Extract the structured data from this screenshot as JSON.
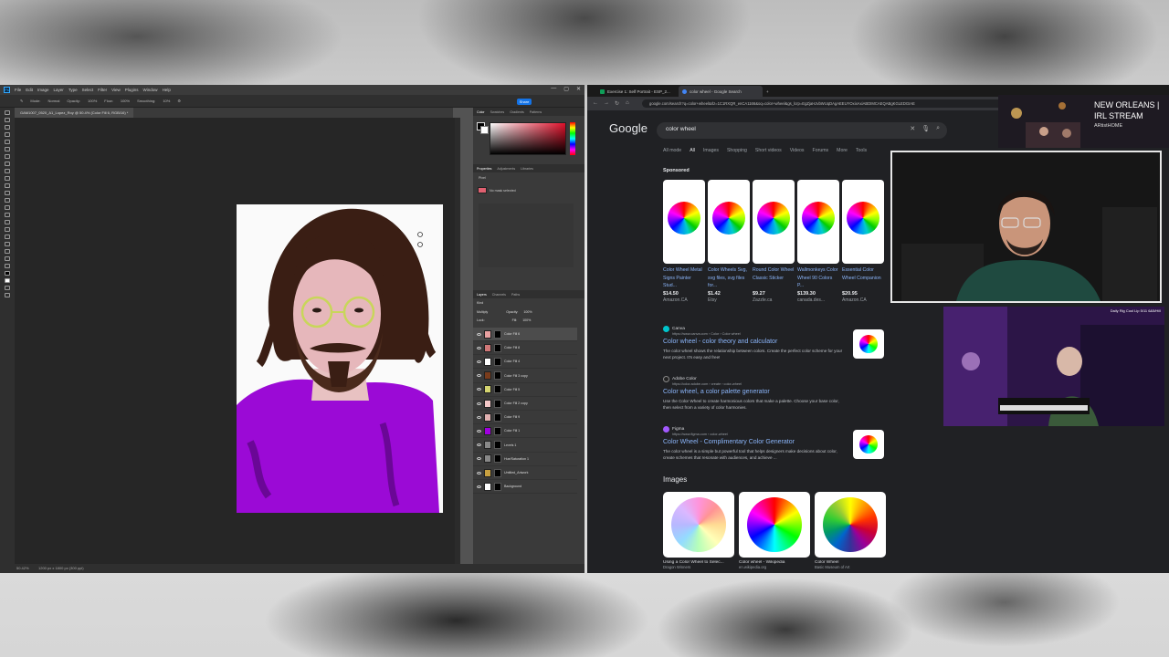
{
  "photoshop": {
    "menu": [
      "File",
      "Edit",
      "Image",
      "Layer",
      "Type",
      "Select",
      "Filter",
      "View",
      "Plugins",
      "Window",
      "Help"
    ],
    "window_controls": [
      "—",
      "▢",
      "✕"
    ],
    "options_bar": [
      "Mode:",
      "Normal",
      "Opacity:",
      "100%",
      "Flow:",
      "100%",
      "Smoothing:",
      "10%"
    ],
    "share_label": "Share",
    "document_tab": "GAM1007_0520_A1_Lopez_Roy @ 50.4% (Color Fill 6, RGB/16) *",
    "status_zoom": "50.42%",
    "status_size": "1200 px x 1800 px (300 ppi)",
    "color_panel_tabs": [
      "Color",
      "Swatches",
      "Gradients",
      "Patterns"
    ],
    "properties_tabs": [
      "Properties",
      "Adjustments",
      "Libraries"
    ],
    "properties_type": "Pixel",
    "properties_msg": "No mask selected",
    "layers_tabs": [
      "Layers",
      "Channels",
      "Paths"
    ],
    "layer_kind": "Kind",
    "blend_mode": "Multiply",
    "opacity_label": "Opacity:",
    "opacity_value": "100%",
    "lock_label": "Lock:",
    "fill_label": "Fill:",
    "fill_value": "100%",
    "layers": [
      {
        "name": "Color Fill 6",
        "color": "#e8a0a0",
        "selected": true
      },
      {
        "name": "Color Fill 8",
        "color": "#d07878"
      },
      {
        "name": "Color Fill 4",
        "color": "#ffffff"
      },
      {
        "name": "Color Fill 3 copy",
        "color": "#7a3c1c"
      },
      {
        "name": "Color Fill 5",
        "color": "#d4d470"
      },
      {
        "name": "Color Fill 2 copy",
        "color": "#f4c8c8"
      },
      {
        "name": "Color Fill 9",
        "color": "#e0b0b0"
      },
      {
        "name": "Color Fill 1",
        "color": "#a000e0"
      },
      {
        "name": "Levels 1",
        "color": "#888888"
      },
      {
        "name": "Hue/Saturation 1",
        "color": "#888888"
      },
      {
        "name": "Untitled_Artwork",
        "color": "#c8a040"
      },
      {
        "name": "Background",
        "color": "#ffffff"
      }
    ]
  },
  "browser": {
    "tabs": [
      {
        "label": "Exercise 1: Self Portrait - ESP_2...",
        "favicon": "#0f9d58"
      },
      {
        "label": "color wheel - Google Search",
        "favicon": "#4285f4"
      }
    ],
    "new_tab": "+",
    "url": "google.com/search?q=color+wheel&rlz=1C1RXQR_enCA1166&oq=color+wheel&gs_lcrp=EgZjaHJvbWUqDAgAEEUYOxixAxiABDIMCAEQABgKGLEDGIAE",
    "nav": [
      "←",
      "→",
      "↻",
      "⌂"
    ]
  },
  "google": {
    "logo": "Google",
    "query": "color wheel",
    "search_icons": [
      "✕",
      "🎙",
      "⌕"
    ],
    "filters": [
      "All mode",
      "All",
      "Images",
      "Shopping",
      "Short videos",
      "Videos",
      "Forums",
      "More",
      "Tools"
    ],
    "sponsored": "Sponsored",
    "products": [
      {
        "title": "Color Wheel Metal Signs Painter Stud...",
        "price": "$14.50",
        "store": "Amazon.CA"
      },
      {
        "title": "Color Wheels Svg, svg files, svg files for...",
        "price": "$1.42",
        "store": "Etsy"
      },
      {
        "title": "Round Color Wheel Classic Sticker",
        "price": "$9.27",
        "store": "Zazzle.ca"
      },
      {
        "title": "Wallmonkeys Color Wheel 90 Colors P...",
        "price": "$139.30",
        "store": "canada.des..."
      },
      {
        "title": "Essential Color Wheel Companion",
        "price": "$20.95",
        "store": "Amazon.CA"
      }
    ],
    "results": [
      {
        "site": "Canva",
        "url": "https://www.canva.com › Color › Color wheel",
        "title": "Color wheel - color theory and calculator",
        "desc": "The color wheel shows the relationship between colors. Create the perfect color scheme for your next project. It's easy and free!",
        "icon": "#00c4cc"
      },
      {
        "site": "Adobe Color",
        "url": "https://color.adobe.com › create › color-wheel",
        "title": "Color wheel, a color palette generator",
        "desc": "Use the Color Wheel to create harmonious colors that make a palette. Choose your base color, then select from a variety of color harmonies.",
        "icon": "#222222"
      },
      {
        "site": "Figma",
        "url": "https://www.figma.com › color-wheel",
        "title": "Color Wheel - Complimentary Color Generator",
        "desc": "The color wheel is a simple but powerful tool that helps designers make decisions about color, create schemes that resonate with audiences, and achieve ...",
        "icon": "#a259ff"
      }
    ],
    "images_heading": "Images",
    "images": [
      {
        "caption": "Using a Color Wheel to Selec...",
        "source": "Dragon Winners"
      },
      {
        "caption": "Color wheel - Wikipedia",
        "source": "en.wikipedia.org"
      },
      {
        "caption": "Color Wheel",
        "source": "Basic Museum of Art"
      }
    ]
  },
  "stream": {
    "title": "NEW ORLEANS | IRL STREAM",
    "brand": "ARtistHOME",
    "side_cam_label": "Daily Rig Cool Lip 5/11 6&5/Hill"
  }
}
